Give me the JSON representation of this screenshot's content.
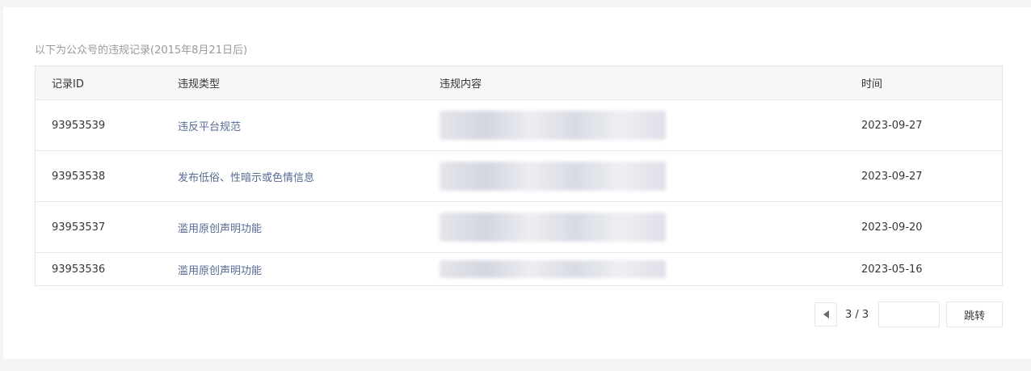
{
  "caption": "以下为公众号的违规记录(2015年8月21日后)",
  "table": {
    "headers": {
      "id": "记录ID",
      "type": "违规类型",
      "content": "违规内容",
      "time": "时间"
    },
    "rows": [
      {
        "id": "93953539",
        "type": "违反平台规范",
        "time": "2023-09-27"
      },
      {
        "id": "93953538",
        "type": "发布低俗、性暗示或色情信息",
        "time": "2023-09-27"
      },
      {
        "id": "93953537",
        "type": "滥用原创声明功能",
        "time": "2023-09-20"
      },
      {
        "id": "93953536",
        "type": "滥用原创声明功能",
        "time": "2023-05-16"
      }
    ]
  },
  "pagination": {
    "page_text": "3 / 3",
    "jump_value": "",
    "jump_label": "跳转",
    "prev_icon": "triangle-left-icon"
  }
}
